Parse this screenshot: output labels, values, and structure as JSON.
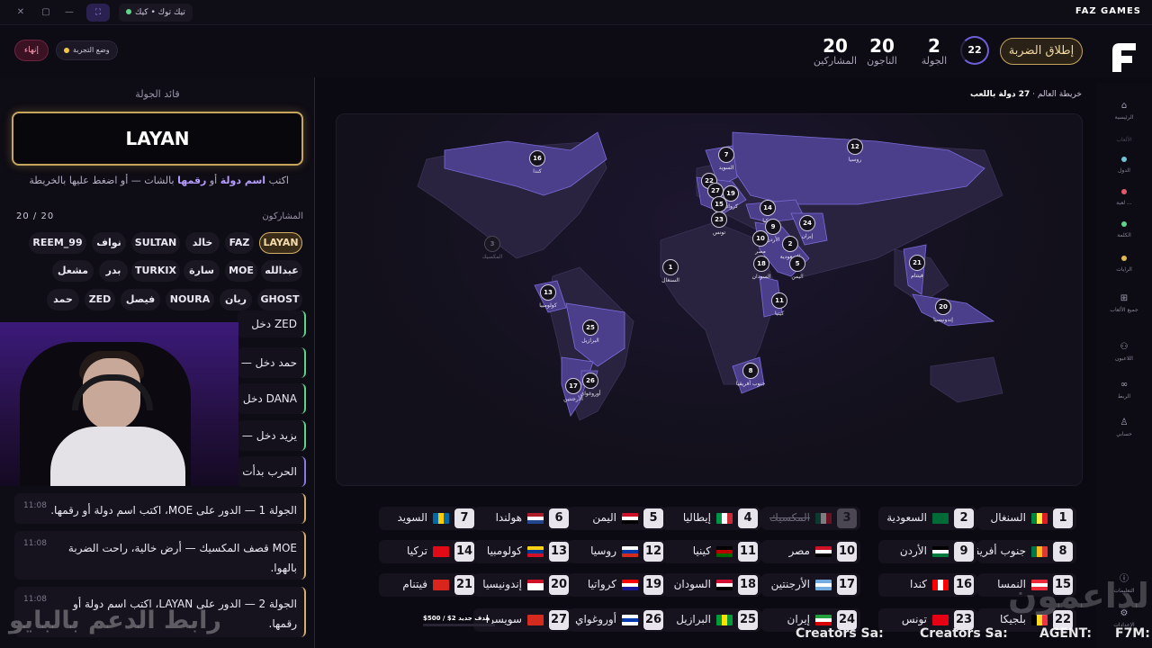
{
  "titlebar": {
    "platforms_label": "تيك توك • كيك",
    "brand": "FAZ GAMES"
  },
  "header": {
    "end_label": "إنهاء",
    "test_mode_label": "وضع التجربة",
    "stats": [
      {
        "num": "20",
        "label": "المشاركين"
      },
      {
        "num": "20",
        "label": "الناجون"
      },
      {
        "num": "2",
        "label": "الجولة"
      }
    ],
    "timer": "22",
    "fire_label": "إطلاق الضربة"
  },
  "nav": {
    "items": [
      {
        "label": "الرئيسية",
        "icon": "home-icon"
      },
      {
        "label": "الألعاب",
        "icon": ""
      },
      {
        "label": "الدول",
        "icon": "globe-icon"
      },
      {
        "label": "لعبة ...",
        "icon": "game-icon"
      },
      {
        "label": "الكلمة",
        "icon": "word-icon"
      },
      {
        "label": "الرايات",
        "icon": "flag-icon"
      },
      {
        "label": "جميع الألعاب",
        "icon": "grid-icon"
      },
      {
        "label": "اللاعبون",
        "icon": "users-icon"
      },
      {
        "label": "الربط",
        "icon": "link-icon"
      },
      {
        "label": "حسابي",
        "icon": "user-icon"
      },
      {
        "label": "التعليمات",
        "icon": "info-icon"
      },
      {
        "label": "الإعدادات",
        "icon": "settings-icon"
      }
    ]
  },
  "left": {
    "title": "قائد الجولة",
    "leader": "LAYAN",
    "hint_pre": "اكتب",
    "hint_b1": "اسم دولة",
    "hint_mid": "أو",
    "hint_b2": "رقمها",
    "hint_post": "بالشات — أو اضغط عليها بالخريطة",
    "participants_title": "المشاركون",
    "participants_count": "20 / 20",
    "participants": [
      [
        "LAYAN",
        "FAZ",
        "خالد",
        "SULTAN",
        "نواف",
        "REEM_99"
      ],
      [
        "عبدالله",
        "MOE",
        "سارة",
        "TURKIX",
        "بدر",
        "مشعل"
      ],
      [
        "GHOST",
        "ريان",
        "NOURA",
        "فيصل",
        "ZED",
        "حمد"
      ]
    ],
    "feed": [
      "ZED دخل —",
      "حمد دخل —",
      "DANA دخل",
      "يزيد دخل —",
      "الحرب بدأت"
    ],
    "messages": [
      {
        "text": "الجولة 1 — الدور على MOE، اكتب اسم دولة أو رقمها.",
        "time": "11:08"
      },
      {
        "text": "MOE قصف المكسيك — أرض خالية، راحت الضربة بالهوا.",
        "time": "11:08"
      },
      {
        "text": "الجولة 2 — الدور على LAYAN، اكتب اسم دولة أو رقمها.",
        "time": "11:08"
      }
    ]
  },
  "map": {
    "title": "خريطة العالم",
    "count_label": "27 دولة باللعب",
    "pins": [
      {
        "n": "16",
        "label": "كندا"
      },
      {
        "n": "7",
        "label": "السويد"
      },
      {
        "n": "12",
        "label": "روسيا"
      },
      {
        "n": "22",
        "label": ""
      },
      {
        "n": "27",
        "label": ""
      },
      {
        "n": "19",
        "label": "كرواتيا"
      },
      {
        "n": "15",
        "label": ""
      },
      {
        "n": "23",
        "label": "تونس"
      },
      {
        "n": "14",
        "label": "تركيا"
      },
      {
        "n": "9",
        "label": "الأردن"
      },
      {
        "n": "24",
        "label": "إيران"
      },
      {
        "n": "10",
        "label": "مصر"
      },
      {
        "n": "2",
        "label": "السعودية"
      },
      {
        "n": "18",
        "label": "السودان"
      },
      {
        "n": "5",
        "label": "اليمن"
      },
      {
        "n": "3",
        "label": "المكسيك",
        "dead": true
      },
      {
        "n": "1",
        "label": "السنغال"
      },
      {
        "n": "11",
        "label": "كينيا"
      },
      {
        "n": "21",
        "label": "فيتنام"
      },
      {
        "n": "20",
        "label": "إندونيسيا"
      },
      {
        "n": "13",
        "label": "كولومبيا"
      },
      {
        "n": "25",
        "label": "البرازيل"
      },
      {
        "n": "26",
        "label": "أوروغواي"
      },
      {
        "n": "17",
        "label": "الأرجنتين"
      },
      {
        "n": "8",
        "label": "جنوب أفريقيا"
      }
    ]
  },
  "countries": [
    {
      "n": "1",
      "name": "السنغال",
      "flag": [
        "#00853f",
        "#fdef42",
        "#e31b23"
      ]
    },
    {
      "n": "2",
      "name": "السعودية",
      "flag": [
        "#006c35",
        "#006c35",
        "#006c35"
      ]
    },
    {
      "n": "3",
      "name": "المكسيك",
      "flag": [
        "#006847",
        "#ffffff",
        "#ce1126"
      ],
      "dead": true
    },
    {
      "n": "4",
      "name": "إيطاليا",
      "flag": [
        "#009246",
        "#ffffff",
        "#ce2b37"
      ]
    },
    {
      "n": "5",
      "name": "اليمن",
      "flag": [
        "#ce1126",
        "#ffffff",
        "#000000"
      ],
      "h": true
    },
    {
      "n": "6",
      "name": "هولندا",
      "flag": [
        "#ae1c28",
        "#ffffff",
        "#21468b"
      ],
      "h": true
    },
    {
      "n": "7",
      "name": "السويد",
      "flag": [
        "#006aa7",
        "#fecc00",
        "#006aa7"
      ]
    },
    {
      "n": "8",
      "name": "جنوب أفريقيا",
      "flag": [
        "#007749",
        "#ffb81c",
        "#de3831"
      ]
    },
    {
      "n": "9",
      "name": "الأردن",
      "flag": [
        "#000000",
        "#ffffff",
        "#007a3d"
      ],
      "h": true
    },
    {
      "n": "10",
      "name": "مصر",
      "flag": [
        "#ce1126",
        "#ffffff",
        "#000000"
      ],
      "h": true
    },
    {
      "n": "11",
      "name": "كينيا",
      "flag": [
        "#000000",
        "#bb0000",
        "#006600"
      ],
      "h": true
    },
    {
      "n": "12",
      "name": "روسيا",
      "flag": [
        "#ffffff",
        "#0039a6",
        "#d52b1e"
      ],
      "h": true
    },
    {
      "n": "13",
      "name": "كولومبيا",
      "flag": [
        "#fcd116",
        "#003893",
        "#ce1126"
      ],
      "h": true
    },
    {
      "n": "14",
      "name": "تركيا",
      "flag": [
        "#e30a17",
        "#e30a17",
        "#e30a17"
      ]
    },
    {
      "n": "15",
      "name": "النمسا",
      "flag": [
        "#ed2939",
        "#ffffff",
        "#ed2939"
      ],
      "h": true
    },
    {
      "n": "16",
      "name": "كندا",
      "flag": [
        "#ff0000",
        "#ffffff",
        "#ff0000"
      ]
    },
    {
      "n": "17",
      "name": "الأرجنتين",
      "flag": [
        "#74acdf",
        "#ffffff",
        "#74acdf"
      ],
      "h": true
    },
    {
      "n": "18",
      "name": "السودان",
      "flag": [
        "#d21034",
        "#ffffff",
        "#000000"
      ],
      "h": true
    },
    {
      "n": "19",
      "name": "كرواتيا",
      "flag": [
        "#ff0000",
        "#ffffff",
        "#171796"
      ],
      "h": true
    },
    {
      "n": "20",
      "name": "إندونيسيا",
      "flag": [
        "#ce1126",
        "#ffffff",
        "#ffffff"
      ],
      "h": true
    },
    {
      "n": "21",
      "name": "فيتنام",
      "flag": [
        "#da251d",
        "#da251d",
        "#da251d"
      ]
    },
    {
      "n": "22",
      "name": "بلجيكا",
      "flag": [
        "#000000",
        "#fdda24",
        "#ef3340"
      ]
    },
    {
      "n": "23",
      "name": "تونس",
      "flag": [
        "#e70013",
        "#e70013",
        "#e70013"
      ]
    },
    {
      "n": "24",
      "name": "إيران",
      "flag": [
        "#239f40",
        "#ffffff",
        "#da0000"
      ],
      "h": true
    },
    {
      "n": "25",
      "name": "البرازيل",
      "flag": [
        "#009c3b",
        "#ffdf00",
        "#009c3b"
      ]
    },
    {
      "n": "26",
      "name": "أوروغواي",
      "flag": [
        "#ffffff",
        "#0038a8",
        "#ffffff"
      ],
      "h": true
    },
    {
      "n": "27",
      "name": "سويسرا",
      "flag": [
        "#d52b1e",
        "#d52b1e",
        "#d52b1e"
      ]
    }
  ],
  "overlay": {
    "support_watermark": "رابط الدعم بالبايو",
    "channel_watermark": "الداعمون",
    "goal": "$500 / $2 هدف جديد",
    "ticker": [
      "Creators Sa:",
      "Creators Sa:",
      "AGENT:",
      "F7M:"
    ]
  }
}
